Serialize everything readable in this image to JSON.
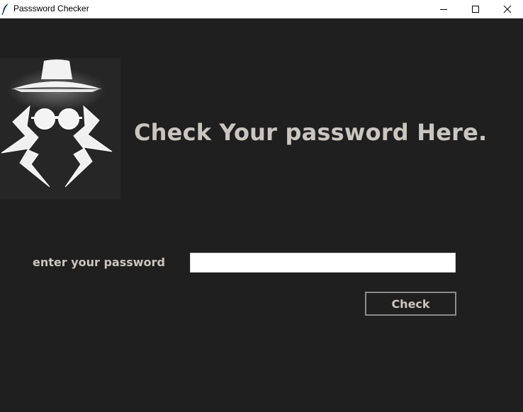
{
  "window": {
    "title": "Passsword Checker",
    "icon": "feather-icon",
    "controls": [
      "minimize-icon",
      "maximize-icon",
      "close-icon"
    ]
  },
  "main": {
    "logo_icon": "spy-incognito-icon",
    "headline": "Check Your password Here.",
    "password_label": "enter your password",
    "password_value": "",
    "check_button_label": "Check"
  },
  "colors": {
    "background": "#1f1f1f",
    "text": "#c9c6c1",
    "button_border": "#8a8a8a",
    "input_background": "#ffffff"
  }
}
